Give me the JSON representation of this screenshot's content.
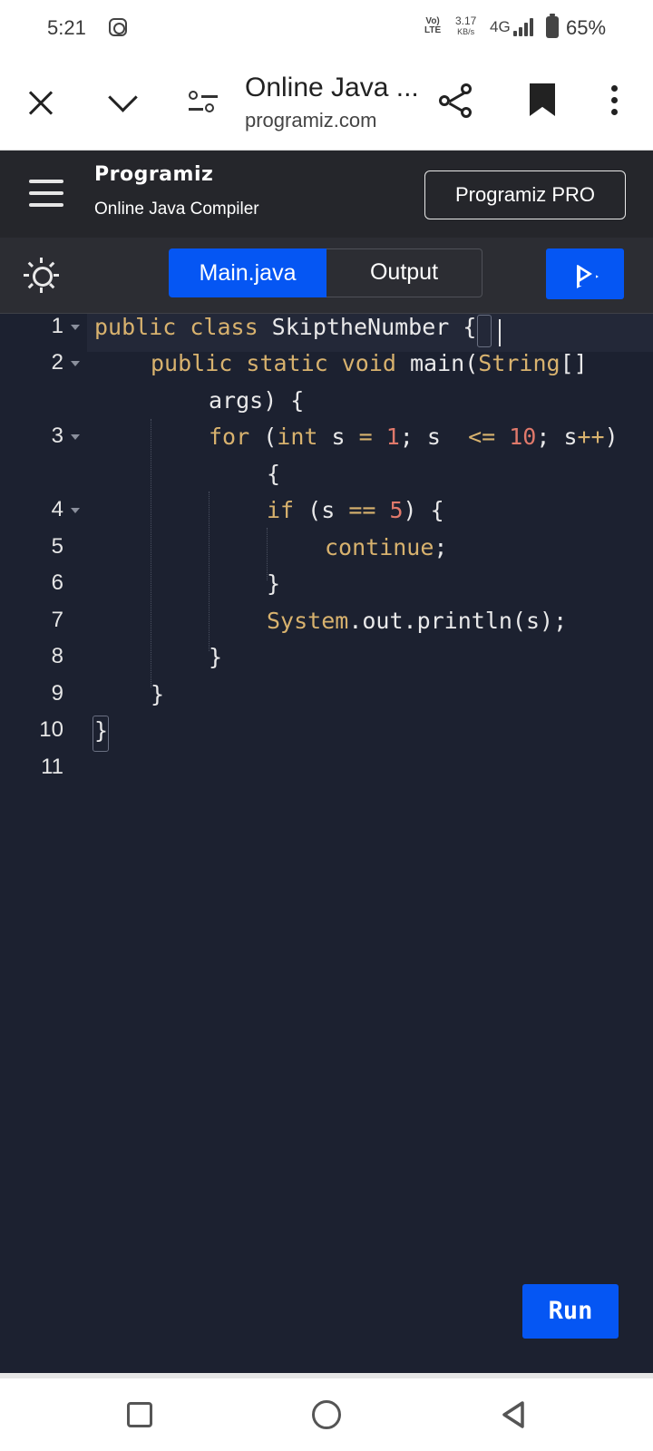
{
  "status_bar": {
    "time": "5:21",
    "volte_top": "Vo)",
    "volte_bottom": "LTE",
    "speed_value": "3.17",
    "speed_unit": "KB/s",
    "network": "4G",
    "battery": "65%",
    "icons": [
      "instagram-icon",
      "signal-icon",
      "battery-icon"
    ]
  },
  "browser": {
    "title": "Online Java ...",
    "url": "programiz.com",
    "icons": [
      "close-icon",
      "chevron-down-icon",
      "site-settings-icon",
      "share-icon",
      "bookmark-icon",
      "more-vert-icon"
    ]
  },
  "header": {
    "logo": "Programiz",
    "subtitle": "Online Java Compiler",
    "pro_button": "Programiz PRO"
  },
  "toolbar": {
    "tabs": [
      {
        "label": "Main.java",
        "active": true
      },
      {
        "label": "Output",
        "active": false
      }
    ],
    "accent": "#0556f3"
  },
  "editor": {
    "line_numbers": [
      "1",
      "2",
      "3",
      "4",
      "5",
      "6",
      "7",
      "8",
      "9",
      "10",
      "11"
    ],
    "lines": [
      "public class SkiptheNumber {",
      "    public static void main(String[]",
      "        args) {",
      "        for (int s = 1; s  <= 10; s++)",
      "            {",
      "            if (s == 5) {",
      "                continue;",
      "            }",
      "            System.out.println(s);",
      "        }",
      "    }",
      "}"
    ],
    "background": "#1c2130",
    "keyword_color": "#d8b26e",
    "number_color": "#e0796b"
  },
  "run_button": "Run",
  "nav": {
    "icons": [
      "recents-icon",
      "home-icon",
      "back-icon"
    ]
  }
}
